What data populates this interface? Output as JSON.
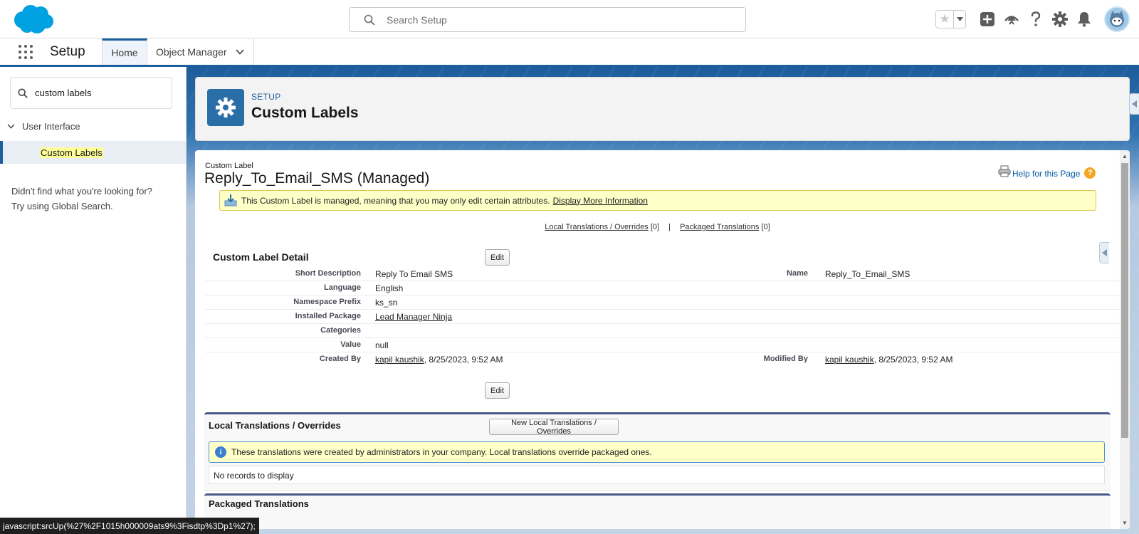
{
  "header": {
    "search_placeholder": "Search Setup",
    "icons": [
      "salesforce-logo",
      "favorites-star-icon",
      "favorites-dropdown-icon",
      "global-actions-add-icon",
      "trailhead-icon",
      "help-icon",
      "setup-gear-icon",
      "notifications-bell-icon",
      "user-avatar"
    ]
  },
  "nav": {
    "app_name": "Setup",
    "tabs": [
      {
        "label": "Home",
        "active": true
      },
      {
        "label": "Object Manager",
        "has_dropdown": true
      }
    ]
  },
  "sidebar": {
    "quick_find_value": "custom labels",
    "tree": {
      "parent_label": "User Interface",
      "child_label": "Custom Labels"
    },
    "not_found_line1": "Didn't find what you're looking for?",
    "not_found_line2": "Try using Global Search."
  },
  "page_header": {
    "eyebrow": "SETUP",
    "title": "Custom Labels"
  },
  "record": {
    "eyebrow": "Custom Label",
    "title": "Reply_To_Email_SMS (Managed)",
    "help_link": "Help for this Page",
    "managed_message": "This Custom Label is managed, meaning that you may only edit certain attributes.",
    "managed_link": "Display More Information",
    "local_link": "Local Translations / Overrides",
    "local_count": "[0]",
    "separator": "|",
    "packaged_link": "Packaged Translations",
    "packaged_count": "[0]",
    "detail_title": "Custom Label Detail",
    "edit_label": "Edit",
    "fields": {
      "short_description_label": "Short Description",
      "short_description": "Reply To Email SMS",
      "name_label": "Name",
      "name": "Reply_To_Email_SMS",
      "language_label": "Language",
      "language": "English",
      "namespace_label": "Namespace Prefix",
      "namespace": "ks_sn",
      "package_label": "Installed Package",
      "package": "Lead Manager Ninja",
      "categories_label": "Categories",
      "categories": "",
      "value_label": "Value",
      "value": "null",
      "created_by_label": "Created By",
      "created_by_user": "kapil kaushik",
      "created_by_date": ", 8/25/2023, 9:52 AM",
      "modified_by_label": "Modified By",
      "modified_by_user": "kapil kaushik",
      "modified_by_date": ", 8/25/2023, 9:52 AM"
    },
    "local_section": {
      "title": "Local Translations / Overrides",
      "new_button": "New Local Translations / Overrides",
      "info": "These translations were created by administrators in your company. Local translations override packaged ones.",
      "empty": "No records to display"
    },
    "packaged_section": {
      "title": "Packaged Translations"
    }
  },
  "status_bar": "javascript:srcUp(%27%2F1015h000009ats9%3Fisdtp%3Dp1%27);",
  "colors": {
    "brand": "#1b5f9e",
    "salesforce_cloud": "#00a1e0",
    "setup_icon_bg": "#2a6ea8",
    "message_bg": "#ffffc8",
    "highlight": "#ffff99"
  }
}
